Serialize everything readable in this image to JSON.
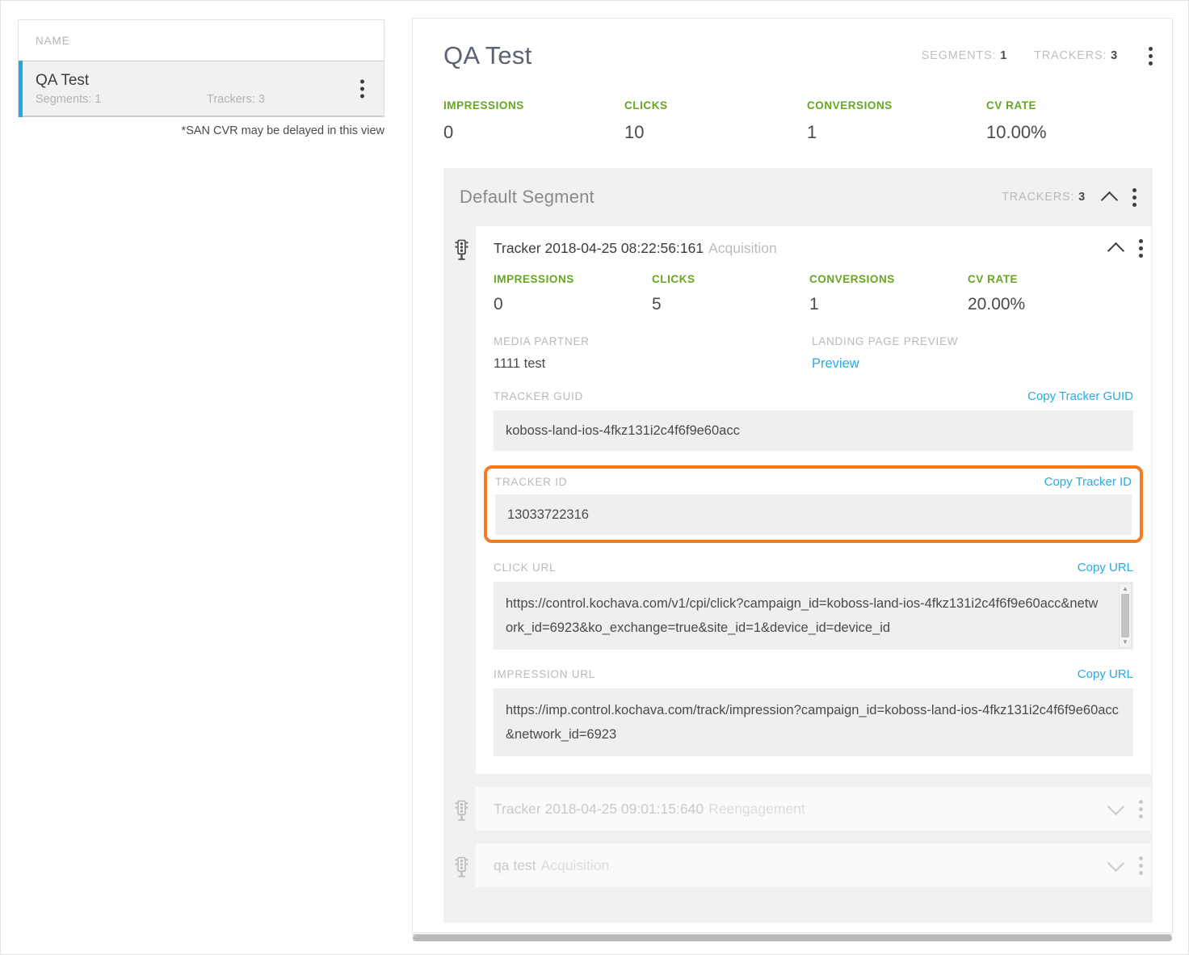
{
  "colors": {
    "green": "#65a721",
    "blue": "#29abe2",
    "orange": "#f47b20",
    "accent_bar": "#26a9e0"
  },
  "left_panel": {
    "column_header": "NAME",
    "row": {
      "title": "QA Test",
      "segments": "Segments: 1",
      "trackers": "Trackers: 3",
      "menu_icon": "kebab-menu-icon"
    },
    "footnote": "*SAN CVR may be delayed in this view"
  },
  "campaign": {
    "title": "QA Test",
    "segments_label": "SEGMENTS:",
    "segments_value": "1",
    "trackers_label": "TRACKERS:",
    "trackers_value": "3",
    "menu_icon": "kebab-menu-icon",
    "stats": [
      {
        "label": "IMPRESSIONS",
        "value": "0"
      },
      {
        "label": "CLICKS",
        "value": "10"
      },
      {
        "label": "CONVERSIONS",
        "value": "1"
      },
      {
        "label": "CV RATE",
        "value": "10.00%"
      }
    ]
  },
  "segment": {
    "title": "Default Segment",
    "trackers_label": "TRACKERS:",
    "trackers_value": "3",
    "collapse_icon": "chevron-up-icon",
    "menu_icon": "kebab-menu-icon"
  },
  "tracker_expanded": {
    "status_icon": "traffic-light-icon",
    "name": "Tracker 2018-04-25 08:22:56:161",
    "type": "Acquisition",
    "collapse_icon": "chevron-up-icon",
    "menu_icon": "kebab-menu-icon",
    "stats": [
      {
        "label": "IMPRESSIONS",
        "value": "0"
      },
      {
        "label": "CLICKS",
        "value": "5"
      },
      {
        "label": "CONVERSIONS",
        "value": "1"
      },
      {
        "label": "CV RATE",
        "value": "20.00%"
      }
    ],
    "media_partner_label": "MEDIA PARTNER",
    "media_partner_value": "1111 test",
    "landing_page_label": "LANDING PAGE PREVIEW",
    "landing_page_link": "Preview",
    "guid_label": "TRACKER GUID",
    "guid_copy": "Copy Tracker GUID",
    "guid_value": "koboss-land-ios-4fkz131i2c4f6f9e60acc",
    "tracker_id_label": "TRACKER ID",
    "tracker_id_copy": "Copy Tracker ID",
    "tracker_id_value": "13033722316",
    "click_url_label": "CLICK URL",
    "click_url_copy": "Copy URL",
    "click_url_value": "https://control.kochava.com/v1/cpi/click?campaign_id=koboss-land-ios-4fkz131i2c4f6f9e60acc&network_id=6923&ko_exchange=true&site_id=1&device_id=device_id",
    "impression_url_label": "IMPRESSION URL",
    "impression_url_copy": "Copy URL",
    "impression_url_value": "https://imp.control.kochava.com/track/impression?campaign_id=koboss-land-ios-4fkz131i2c4f6f9e60acc&network_id=6923"
  },
  "trackers_collapsed": [
    {
      "status_icon": "traffic-light-icon",
      "name": "Tracker 2018-04-25 09:01:15:640",
      "type": "Reengagement",
      "expand_icon": "chevron-down-icon",
      "menu_icon": "kebab-menu-icon"
    },
    {
      "status_icon": "traffic-light-icon",
      "name": "qa test",
      "type": "Acquisition",
      "expand_icon": "chevron-down-icon",
      "menu_icon": "kebab-menu-icon"
    }
  ]
}
